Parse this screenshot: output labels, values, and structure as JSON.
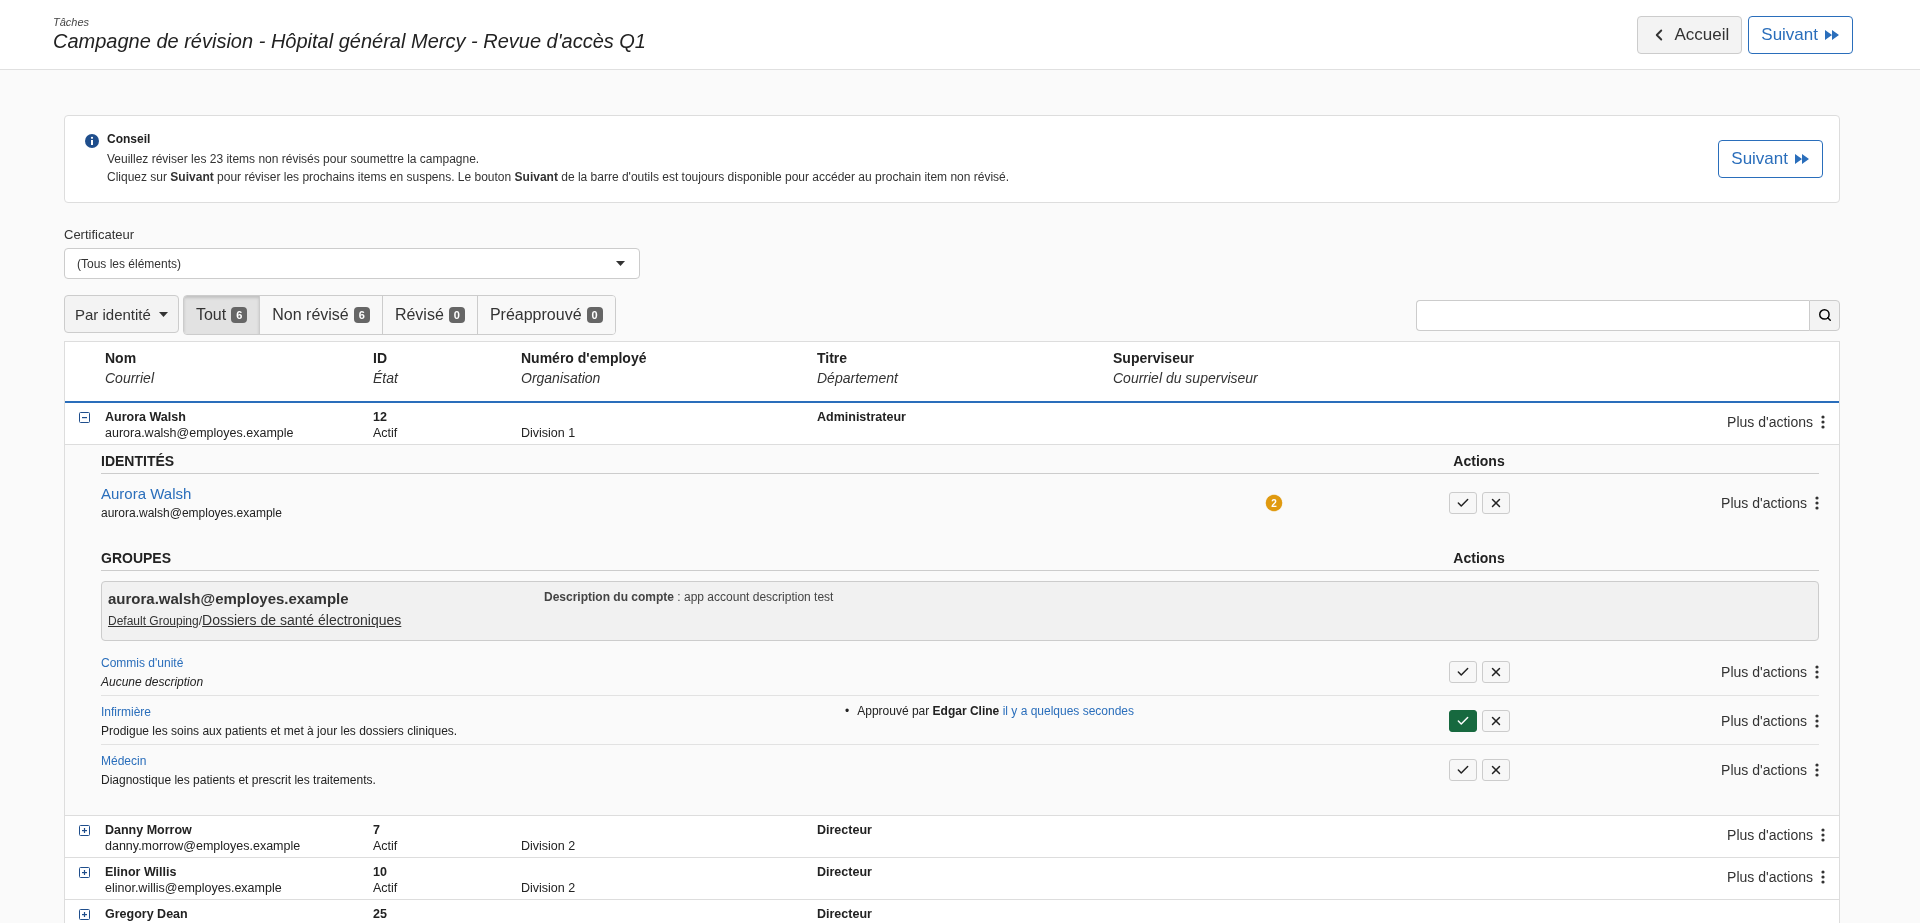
{
  "header": {
    "breadcrumb": "Tâches",
    "title": "Campagne de révision - Hôpital général Mercy - Revue d'accès Q1",
    "back_button": "Accueil",
    "next_button": "Suivant"
  },
  "tip": {
    "title": "Conseil",
    "lines": [
      "Veuillez réviser les 23 items non révisés pour soumettre la campagne.",
      "Cliquez sur **Suivant** pour réviser les prochains items en suspens. Le bouton **Suivant** de la barre d'outils est toujours disponible pour accéder au prochain item non révisé."
    ],
    "button": "Suivant"
  },
  "certifier": {
    "label": "Certificateur",
    "value": "(Tous les éléments)"
  },
  "group_by": "Par identité",
  "filters": [
    {
      "label": "Tout",
      "count": "6",
      "selected": true
    },
    {
      "label": "Non révisé",
      "count": "6",
      "selected": false
    },
    {
      "label": "Révisé",
      "count": "0",
      "selected": false
    },
    {
      "label": "Préapprouvé",
      "count": "0",
      "selected": false
    }
  ],
  "table": {
    "columns": [
      {
        "title": "Nom",
        "subtitle": "Courriel"
      },
      {
        "title": "ID",
        "subtitle": "État"
      },
      {
        "title": "Numéro d'employé",
        "subtitle": "Organisation"
      },
      {
        "title": "Titre",
        "subtitle": "Département"
      },
      {
        "title": "Superviseur",
        "subtitle": "Courriel du superviseur"
      }
    ],
    "rows": [
      {
        "name": "Aurora Walsh",
        "email": "aurora.walsh@employes.example",
        "id": "12",
        "status": "Actif",
        "organization": "Division 1",
        "title": "Administrateur",
        "expanded": true,
        "more": "Plus d'actions",
        "details": {
          "identities_heading": "IDENTITÉS",
          "identities_actions": "Actions",
          "identity": {
            "name": "Aurora Walsh",
            "email": "aurora.walsh@employes.example",
            "badge": "2",
            "approved": false,
            "more": "Plus d'actions"
          },
          "groups_heading": "GROUPES",
          "groups_actions": "Actions",
          "account": {
            "name": "aurora.walsh@employes.example",
            "path_root": "Default Grouping",
            "path_separator": "/",
            "path_leaf": "Dossiers de santé électroniques",
            "description": "**Description du compte** : app account description test"
          },
          "entitlements": [
            {
              "name": "Commis d'unité",
              "description": "Aucune description",
              "kind": "empty",
              "approved": false,
              "more": "Plus d'actions"
            },
            {
              "name": "Infirmière",
              "description": "Prodigue les soins aux patients et met à jour les dossiers cliniques.",
              "kind": "text",
              "approved": true,
              "approval": {
                "bullet": "•",
                "prefix": "Approuvé par",
                "by": "Edgar Cline",
                "when": "il y a quelques secondes"
              },
              "more": "Plus d'actions"
            },
            {
              "name": "Médecin",
              "description": "Diagnostique les patients et prescrit les traitements.",
              "kind": "text",
              "approved": false,
              "more": "Plus d'actions"
            }
          ]
        }
      },
      {
        "name": "Danny Morrow",
        "email": "danny.morrow@employes.example",
        "id": "7",
        "status": "Actif",
        "organization": "Division 2",
        "title": "Directeur",
        "expanded": false,
        "more": "Plus d'actions"
      },
      {
        "name": "Elinor Willis",
        "email": "elinor.willis@employes.example",
        "id": "10",
        "status": "Actif",
        "organization": "Division 2",
        "title": "Directeur",
        "expanded": false,
        "more": "Plus d'actions"
      },
      {
        "name": "Gregory Dean",
        "id": "25",
        "title": "Directeur",
        "expanded": false
      }
    ]
  }
}
